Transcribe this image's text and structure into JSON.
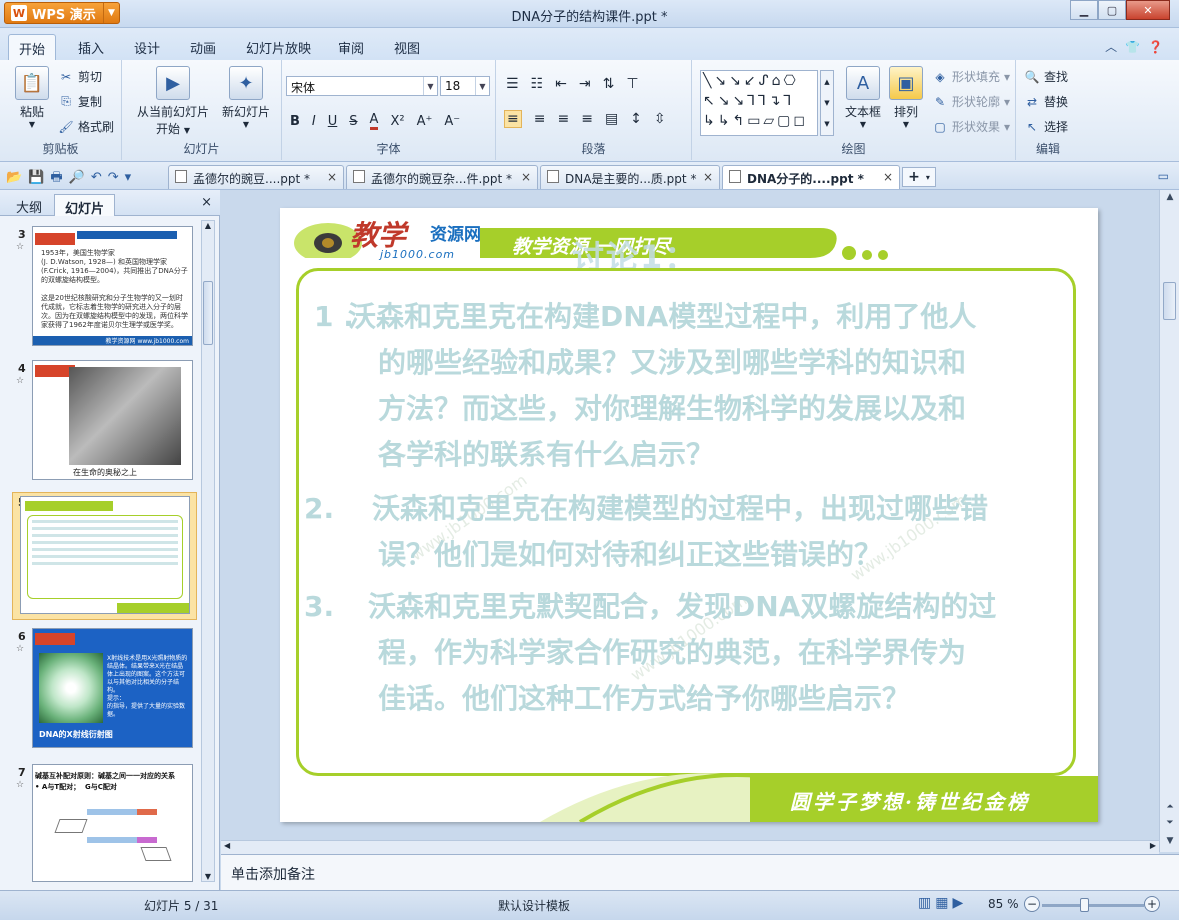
{
  "app": {
    "brand": "WPS 演示",
    "brand_logo": "W",
    "title": "DNA分子的结构课件.ppt *"
  },
  "menu_tabs": [
    "开始",
    "插入",
    "设计",
    "动画",
    "幻灯片放映",
    "审阅",
    "视图"
  ],
  "ribbon": {
    "clipboard": {
      "paste": "粘贴",
      "cut": "剪切",
      "copy": "复制",
      "format_painter": "格式刷",
      "label": "剪贴板"
    },
    "slides": {
      "from_current": "从当前幻灯片",
      "start": "开始",
      "new_slide": "新幻灯片",
      "label": "幻灯片"
    },
    "font": {
      "name": "宋体",
      "size": "18",
      "label": "字体"
    },
    "paragraph": {
      "label": "段落"
    },
    "drawing": {
      "textbox": "文本框",
      "arrange": "排列",
      "shape_fill": "形状填充",
      "shape_outline": "形状轮廓",
      "shape_effect": "形状效果",
      "label": "绘图"
    },
    "editing": {
      "find": "查找",
      "replace": "替换",
      "select": "选择",
      "label": "编辑"
    }
  },
  "doc_tabs": [
    {
      "label": "孟德尔的豌豆....ppt *",
      "active": false
    },
    {
      "label": "孟德尔的豌豆杂...件.ppt *",
      "active": false
    },
    {
      "label": "DNA是主要的...质.ppt *",
      "active": false
    },
    {
      "label": "DNA分子的....ppt *",
      "active": true
    }
  ],
  "left_panel": {
    "tabs": [
      "大纲",
      "幻灯片"
    ],
    "close": "×",
    "slides": [
      {
        "num": "3",
        "text": "1953年，美国生物学家\n(J. D.Watson, 1928—) 和英国物理学家 (F.Crick, 1916—2004)，共同推出了DNA分子的双螺旋结构模型。\n\n这是20世纪核酸研究和分子生物学的又一划时代成就，它标志着生物学的研究进入分子的层次。因为在双螺旋结构模型中的发现，两位科学家获得了1962年度诺贝尔生理学或医学奖。",
        "footer": "教学资源网 www.jb1000.com"
      },
      {
        "num": "4",
        "text": "在生命的奥秘之上",
        "footer": ""
      },
      {
        "num": "5",
        "text": "",
        "footer": ""
      },
      {
        "num": "6",
        "text": "X射线技术是用X光照射物质的结晶体。结果带来X光在结晶体上出现的图案。这个方法可以与其他对比相关的分子结构。\n提示：\n的指导，提供了大量的实验数据。",
        "caption": "DNA的X射线衍射图",
        "footer": ""
      },
      {
        "num": "7",
        "text": "碱基互补配对原则：碱基之间一一对应的关系\n• A与T配对；  G与C配对",
        "footer": ""
      }
    ]
  },
  "slide": {
    "logo_title": "教学",
    "logo_sub": "资源网",
    "logo_url": "jb1000.com",
    "slogan": "教学资源 一网打尽",
    "title": "讨论1：",
    "questions": [
      {
        "num": "1 .",
        "lines": [
          "沃森和克里克在构建DNA模型过程中，利用了他人",
          "的哪些经验和成果？又涉及到哪些学科的知识和",
          "方法？而这些，对你理解生物科学的发展以及和",
          "各学科的联系有什么启示？"
        ]
      },
      {
        "num": "2.",
        "lines": [
          "沃森和克里克在构建模型的过程中，出现过哪些错",
          "误？他们是如何对待和纠正这些错误的？"
        ]
      },
      {
        "num": "3.",
        "lines": [
          "沃森和克里克默契配合，发现DNA双螺旋结构的过",
          "程，作为科学家合作研究的典范，在科学界传为",
          "佳话。他们这种工作方式给予你哪些启示？"
        ]
      }
    ],
    "footer": "圆学子梦想·铸世纪金榜",
    "watermark": "www.jb1000.com"
  },
  "notes_placeholder": "单击添加备注",
  "status": {
    "slide_counter": "幻灯片 5 / 31",
    "template": "默认设计模板",
    "zoom": "85 %"
  }
}
